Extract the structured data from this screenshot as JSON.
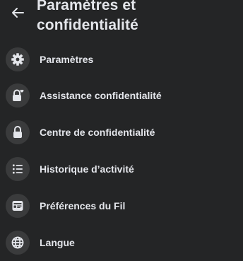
{
  "header": {
    "title": "Paramètres et\nconfidentialité",
    "back_icon": "arrow-left-icon"
  },
  "menu": {
    "items": [
      {
        "label": "Paramètres",
        "icon": "gear-icon"
      },
      {
        "label": "Assistance confidentialité",
        "icon": "lock-heart-icon"
      },
      {
        "label": "Centre de confidentialité",
        "icon": "lock-icon"
      },
      {
        "label": "Historique d’activité",
        "icon": "list-icon"
      },
      {
        "label": "Préférences du Fil",
        "icon": "feed-icon"
      },
      {
        "label": "Langue",
        "icon": "globe-icon"
      }
    ]
  },
  "colors": {
    "background": "#242526",
    "icon_circle": "#3a3b3c",
    "text": "#e4e6eb"
  }
}
